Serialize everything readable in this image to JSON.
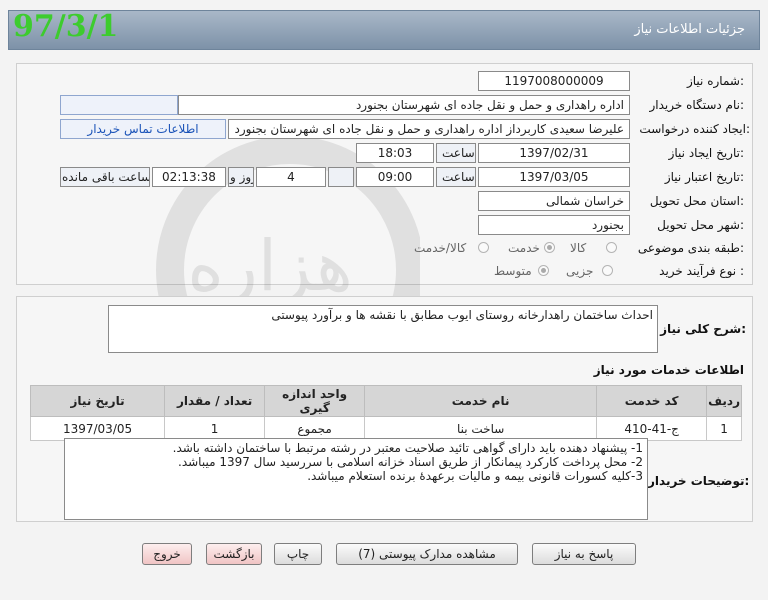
{
  "header": {
    "title": "جزئیات اطلاعات نیاز",
    "stamp": "97/3/1"
  },
  "form": {
    "need_number_label": "شماره نیاز:",
    "need_number": "1197008000009",
    "buyer_org_label": "نام دستگاه خریدار:",
    "buyer_org": "اداره راهداری و حمل و نقل جاده ای شهرستان بجنورد",
    "requester_label": "ایجاد کننده درخواست:",
    "requester": "علیرضا سعیدی کاربرداز اداره راهداری و حمل و نقل جاده ای شهرستان بجنورد",
    "contact_link": "اطلاعات تماس خریدار",
    "created_label": "تاریخ ایجاد نیاز:",
    "created_date": "1397/02/31",
    "time_word": "ساعت",
    "created_time": "18:03",
    "valid_label": "تاریخ اعتبار نیاز:",
    "valid_date": "1397/03/05",
    "valid_time": "09:00",
    "days_value": "4",
    "day_and": "روز و",
    "remaining_time": "02:13:38",
    "remaining_label": "ساعت باقی مانده",
    "province_label": "استان محل تحویل:",
    "province": "خراسان شمالی",
    "city_label": "شهر محل تحویل:",
    "city": "بجنورد",
    "category_label": "طبقه بندی موضوعی:",
    "category_options": [
      "کالا",
      "خدمت",
      "کالا/خدمت"
    ],
    "category_selected": "خدمت",
    "process_label": "نوع فرآیند خرید :",
    "process_options": [
      "جزیی",
      "متوسط"
    ],
    "process_selected": "متوسط"
  },
  "description": {
    "label": "شرح کلی نیاز:",
    "text": "احداث ساختمان راهدارخانه روستای ایوب مطابق با نقشه ها و برآورد پیوستی"
  },
  "services": {
    "title": "اطلاعات خدمات مورد نیاز",
    "columns": [
      "ردیف",
      "کد خدمت",
      "نام خدمت",
      "واحد اندازه گیری",
      "تعداد / مقدار",
      "تاریخ نیاز"
    ],
    "rows": [
      [
        "1",
        "ج-41-410",
        "ساخت بنا",
        "مجموع",
        "1",
        "1397/03/05"
      ]
    ]
  },
  "buyer_notes": {
    "label": "توضیحات خریدار:",
    "lines": [
      "1- پیشنهاد دهنده باید دارای گواهی تائید صلاحیت معتبر در رشته مرتبط با ساختمان داشته باشد.",
      "2- محل پرداخت کارکرد پیمانکار از طریق اسناد خزانه اسلامی با سررسید سال 1397 میباشد.",
      "3-کلیه کسورات قانونی بیمه و مالیات برعهدۀ برنده استعلام میباشد."
    ]
  },
  "buttons": {
    "respond": "پاسخ به نیاز",
    "view_docs": "مشاهده مدارک پیوستی (7)",
    "print": "چاپ",
    "back": "بازگشت",
    "exit": "خروج"
  },
  "watermark": {
    "text": "هزاره",
    "subtext": "گستران",
    "brand": "ارتباط"
  },
  "colors": {
    "title_bg": "#8a9db2",
    "stamp": "#3dcc2e",
    "link": "#1a53b8"
  }
}
